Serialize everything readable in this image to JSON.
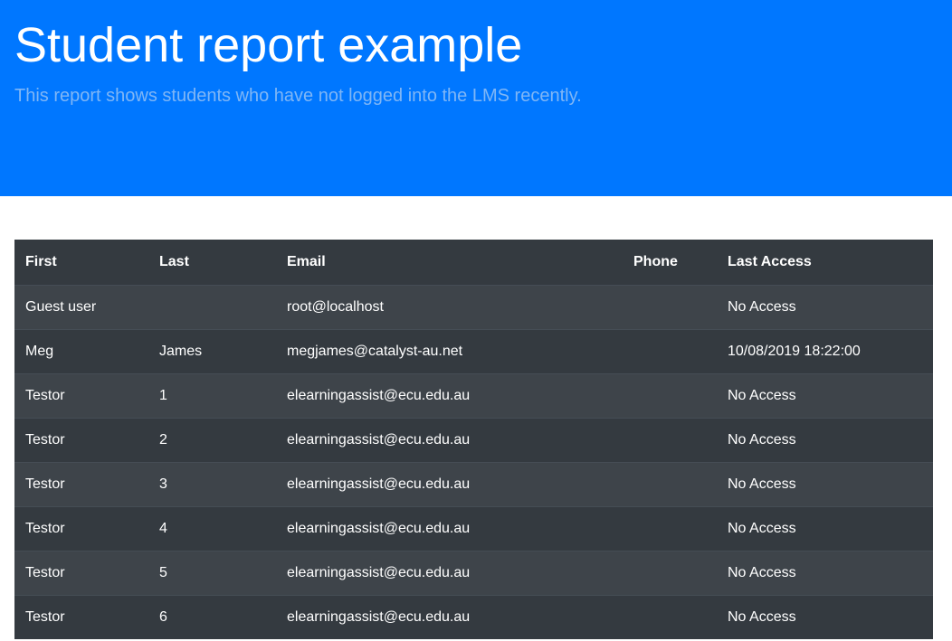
{
  "header": {
    "title": "Student report example",
    "subtitle": "This report shows students who have not logged into the LMS recently."
  },
  "table": {
    "columns": [
      "First",
      "Last",
      "Email",
      "Phone",
      "Last Access"
    ],
    "rows": [
      [
        "Guest user",
        "",
        "root@localhost",
        "",
        "No Access"
      ],
      [
        "Meg",
        "James",
        "megjames@catalyst-au.net",
        "",
        "10/08/2019 18:22:00"
      ],
      [
        "Testor",
        "1",
        "elearningassist@ecu.edu.au",
        "",
        "No Access"
      ],
      [
        "Testor",
        "2",
        "elearningassist@ecu.edu.au",
        "",
        "No Access"
      ],
      [
        "Testor",
        "3",
        "elearningassist@ecu.edu.au",
        "",
        "No Access"
      ],
      [
        "Testor",
        "4",
        "elearningassist@ecu.edu.au",
        "",
        "No Access"
      ],
      [
        "Testor",
        "5",
        "elearningassist@ecu.edu.au",
        "",
        "No Access"
      ],
      [
        "Testor",
        "6",
        "elearningassist@ecu.edu.au",
        "",
        "No Access"
      ]
    ]
  },
  "colors": {
    "hero_background": "#0077ff",
    "table_dark": "#343a40",
    "table_stripe": "#3e444a"
  }
}
